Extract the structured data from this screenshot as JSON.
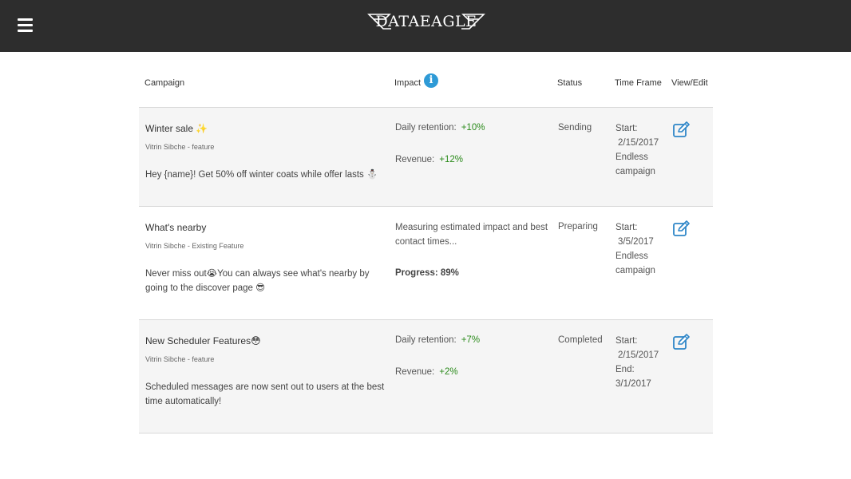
{
  "header": {
    "menu_icon": "hamburger-menu-icon",
    "logo_text": "DATAEAGLE"
  },
  "colors": {
    "topbar": "#2d2d2d",
    "accent": "#2e9ad6",
    "positive": "#2a8a1a",
    "row_shade": "#f5f5f5"
  },
  "table": {
    "columns": {
      "campaign": "Campaign",
      "impact": "Impact",
      "status": "Status",
      "time_frame": "Time Frame",
      "view_edit": "View/Edit"
    },
    "impact_info_icon": "info-icon",
    "rows": [
      {
        "title": "Winter sale ✨",
        "subtitle": "Vitrin Sibche - feature",
        "message": "Hey {name}! Get 50% off winter coats while offer lasts ⛄",
        "impact": {
          "retention_label": "Daily retention:",
          "retention_value": "+10%",
          "revenue_label": "Revenue:",
          "revenue_value": "+12%"
        },
        "status": "Sending",
        "time_frame": [
          "Start:",
          "2/15/2017",
          "Endless",
          "campaign"
        ],
        "edit_icon": "edit-icon"
      },
      {
        "title": "What's nearby",
        "subtitle": "Vitrin Sibche - Existing Feature",
        "message": "Never miss out😭You can always see what's nearby by going to the discover page 😎",
        "impact": {
          "measuring_text": "Measuring estimated impact and best contact times...",
          "progress_label": "Progress: 89%"
        },
        "status": "Preparing",
        "time_frame": [
          "Start:",
          "3/5/2017",
          "Endless",
          "campaign"
        ],
        "edit_icon": "edit-icon"
      },
      {
        "title": "New Scheduler Features😳",
        "subtitle": "Vitrin Sibche - feature",
        "message": "Scheduled messages are now sent out to users at the best time automatically!",
        "impact": {
          "retention_label": "Daily retention:",
          "retention_value": "+7%",
          "revenue_label": "Revenue:",
          "revenue_value": "+2%"
        },
        "status": "Completed",
        "time_frame": [
          "Start:",
          "2/15/2017",
          "End:",
          "3/1/2017"
        ],
        "edit_icon": "edit-icon"
      }
    ]
  }
}
